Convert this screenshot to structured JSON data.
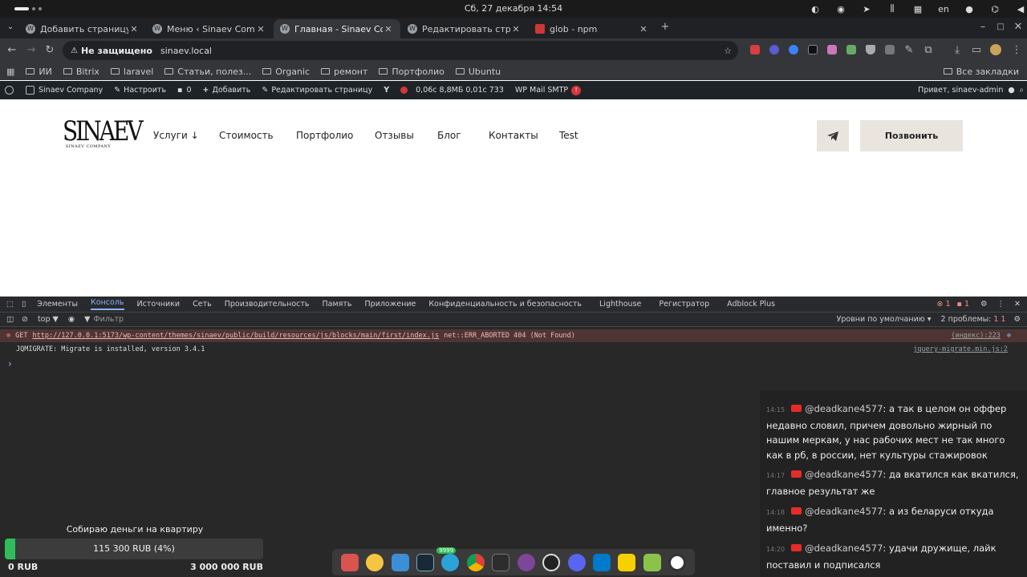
{
  "system_bar": {
    "clock": "Сб, 27 декабря  14:54",
    "language": "en"
  },
  "browser": {
    "tabs": [
      {
        "title": "Добавить страницу ‹ Sinaev",
        "icon": "wordpress-icon"
      },
      {
        "title": "Меню ‹ Sinaev Company — W",
        "icon": "wordpress-icon"
      },
      {
        "title": "Главная - Sinaev Company",
        "icon": "wordpress-icon",
        "active": true
      },
      {
        "title": "Редактировать страницу ‹",
        "icon": "wordpress-icon"
      },
      {
        "title": "glob - npm",
        "icon": "npm-icon"
      }
    ],
    "address": {
      "security_label": "Не защищено",
      "url": "sinaev.local"
    },
    "bookmarks": [
      "ИИ",
      "Bitrix",
      "laravel",
      "Статьи, полез...",
      "Organic",
      "ремонт",
      "Портфолио",
      "Ubuntu"
    ],
    "all_bookmarks": "Все закладки"
  },
  "wp_admin_bar": {
    "site": "Sinaev Company",
    "customize": "Настроить",
    "comments": "0",
    "add": "Добавить",
    "edit_page": "Редактировать страницу",
    "stats": "0,06с  8,8МБ  0,01с  733",
    "smtp": "WP Mail SMTP",
    "smtp_badge": "!",
    "greeting": "Привет, sinaev-admin"
  },
  "site": {
    "logo_text": "SINAEV",
    "logo_sub": "SINAEV COMPANY",
    "menu": [
      "Услуги ↓",
      "Стоимость",
      "Портфолио",
      "Отзывы",
      "Блог",
      "Контакты",
      "Test"
    ],
    "call_button": "Позвонить"
  },
  "devtools": {
    "tabs": [
      "Элементы",
      "Консоль",
      "Источники",
      "Сеть",
      "Производительность",
      "Память",
      "Приложение",
      "Конфиденциальность и безопасность",
      "Lighthouse",
      "Регистратор",
      "Adblock Plus"
    ],
    "active_tab": "Консоль",
    "error_count": "1",
    "issue_count": "1",
    "context": "top ▼",
    "filter_placeholder": "Фильтр",
    "levels": "Уровни по умолчанию ▾",
    "problems": "2 проблемы:",
    "problems_badge": "1",
    "problems_badge2": "1",
    "error": {
      "method": "GET",
      "url": "http://127.0.0.1:5173/wp-content/themes/sinaev/public/build/resources/js/blocks/main/first/index.js",
      "message": "net::ERR_ABORTED 404 (Not Found)",
      "source": "(индекс):223"
    },
    "info": {
      "message": "JQMIGRATE: Migrate is installed, version 3.4.1",
      "source": "jquery-migrate.min.js:2"
    },
    "prompt": "›"
  },
  "chat": {
    "messages": [
      {
        "time": "14:15",
        "user": "@deadkane4577",
        "text": "а так в целом он оффер недавно словил, причем довольно жирный по нашим меркам, у нас рабочих мест не так много как в рб, в россии, нет культуры стажировок"
      },
      {
        "time": "14:17",
        "user": "@deadkane4577",
        "text": "да вкатился как вкатился, главное результат же"
      },
      {
        "time": "14:18",
        "user": "@deadkane4577",
        "text": "а из беларуси откуда именно?"
      },
      {
        "time": "14:20",
        "user": "@deadkane4577",
        "text": "удачи дружище, лайк поставил и подписался"
      }
    ]
  },
  "donation": {
    "title": "Собираю деньги на квартиру",
    "progress_text": "115 300 RUB (4%)",
    "progress": 0.04,
    "min_label": "0 RUB",
    "max_label": "3 000 000 RUB"
  },
  "dock": {
    "apps": [
      "files-icon",
      "rhythmbox-icon",
      "text-editor-icon",
      "steam-icon",
      "telegram-icon",
      "chrome-icon",
      "terminal-icon",
      "tor-icon",
      "obs-icon",
      "discord-icon",
      "vscode-icon",
      "beekeeper-icon",
      "trash-icon",
      "ubuntu-icon"
    ],
    "telegram_badge": "9999"
  },
  "colors": {
    "accent_beige": "#e9e4de",
    "devtools_bg": "#282828",
    "error_bg": "#4e3534",
    "progress_green": "#2ebd59"
  }
}
